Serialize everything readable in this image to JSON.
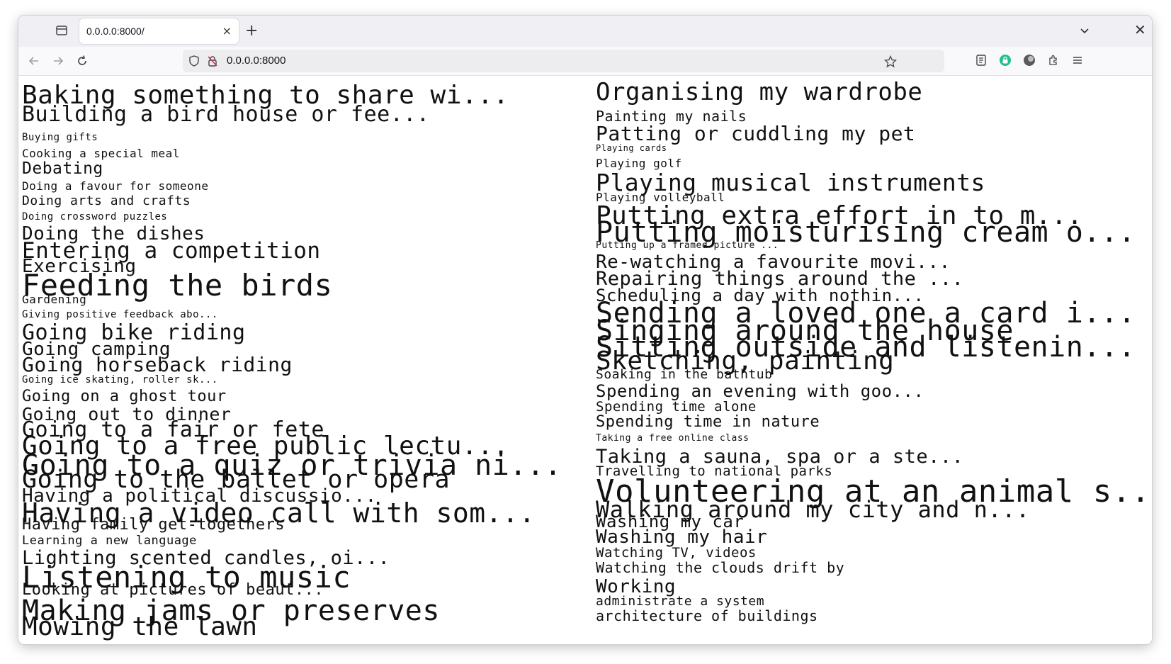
{
  "browser": {
    "tab_title": "0.0.0.0:8000/",
    "tab_close": "×",
    "new_tab": "+",
    "url": "0.0.0.0:8000",
    "window_close": "✕"
  },
  "left_items": [
    {
      "text": "Baking something to share wi...",
      "size": 36
    },
    {
      "text": "Building a bird house or fee...",
      "size": 30
    },
    {
      "text": "Buying gifts",
      "size": 14
    },
    {
      "text": "Cooking a special meal",
      "size": 16
    },
    {
      "text": "Debating",
      "size": 23
    },
    {
      "text": "Doing a favour for someone",
      "size": 16
    },
    {
      "text": "Doing arts and crafts",
      "size": 18
    },
    {
      "text": "Doing crossword puzzles",
      "size": 14
    },
    {
      "text": "Doing the dishes",
      "size": 26
    },
    {
      "text": "Entering a competition",
      "size": 31
    },
    {
      "text": "Exercising",
      "size": 26
    },
    {
      "text": "Feeding the birds",
      "size": 42
    },
    {
      "text": "Gardening",
      "size": 16
    },
    {
      "text": "Giving positive feedback abo...",
      "size": 14
    },
    {
      "text": "Going bike riding",
      "size": 30
    },
    {
      "text": "Going camping",
      "size": 26
    },
    {
      "text": "Going horseback riding",
      "size": 28
    },
    {
      "text": "Going ice skating, roller sk...",
      "size": 14
    },
    {
      "text": "Going on a ghost tour",
      "size": 22
    },
    {
      "text": "Going out to dinner",
      "size": 25
    },
    {
      "text": "Going to a fair or fete",
      "size": 30
    },
    {
      "text": "Going to a free public lectu...",
      "size": 36
    },
    {
      "text": "Going to a quiz or trivia ni...",
      "size": 40
    },
    {
      "text": "Going to the ballet or opera",
      "size": 35
    },
    {
      "text": "Having a political discussio...",
      "size": 26
    },
    {
      "text": "Having a video call with som...",
      "size": 38
    },
    {
      "text": "Having family get-togethers",
      "size": 22
    },
    {
      "text": "Learning a new language",
      "size": 17
    },
    {
      "text": "Lighting scented candles, oi...",
      "size": 27
    },
    {
      "text": "Listening to music",
      "size": 42
    },
    {
      "text": "Looking at pictures of beaut...",
      "size": 22
    },
    {
      "text": "Making jams or preserves",
      "size": 40
    },
    {
      "text": "Mowing the lawn",
      "size": 36
    }
  ],
  "right_items": [
    {
      "text": "Organising my wardrobe",
      "size": 34
    },
    {
      "text": "Painting my nails",
      "size": 20
    },
    {
      "text": "Patting or cuddling my pet",
      "size": 28
    },
    {
      "text": "Playing cards",
      "size": 12
    },
    {
      "text": "Playing golf",
      "size": 16
    },
    {
      "text": "Playing musical instruments",
      "size": 33
    },
    {
      "text": "Playing volleyball",
      "size": 16
    },
    {
      "text": "Putting extra effort in to m...",
      "size": 36
    },
    {
      "text": "Putting moisturising cream o...",
      "size": 40
    },
    {
      "text": "Putting up a framed picture ...",
      "size": 13
    },
    {
      "text": "Re-watching a favourite movi...",
      "size": 26
    },
    {
      "text": "Repairing things around the ...",
      "size": 27
    },
    {
      "text": "Scheduling a day with nothin...",
      "size": 24
    },
    {
      "text": "Sending a loved one a card i...",
      "size": 40
    },
    {
      "text": "Singing around the house",
      "size": 40
    },
    {
      "text": "Sitting outside and listenin...",
      "size": 40
    },
    {
      "text": "Sketching, painting",
      "size": 36
    },
    {
      "text": "Soaking in the bathtub",
      "size": 18
    },
    {
      "text": "Spending an evening with goo...",
      "size": 24
    },
    {
      "text": "Spending time alone",
      "size": 19
    },
    {
      "text": "Spending time in nature",
      "size": 22
    },
    {
      "text": "Taking a free online class",
      "size": 13
    },
    {
      "text": "Taking a sauna, spa or a ste...",
      "size": 27
    },
    {
      "text": "Travelling to national parks",
      "size": 19
    },
    {
      "text": "Volunteering at an animal s...",
      "size": 44
    },
    {
      "text": "Walking around my city and n...",
      "size": 32
    },
    {
      "text": "Washing my car",
      "size": 24
    },
    {
      "text": "Washing my hair",
      "size": 26
    },
    {
      "text": "Watching TV, videos",
      "size": 19
    },
    {
      "text": "Watching the clouds drift by",
      "size": 20
    },
    {
      "text": "Working",
      "size": 26
    },
    {
      "text": "administrate a system",
      "size": 18
    },
    {
      "text": "architecture of buildings",
      "size": 20
    }
  ]
}
